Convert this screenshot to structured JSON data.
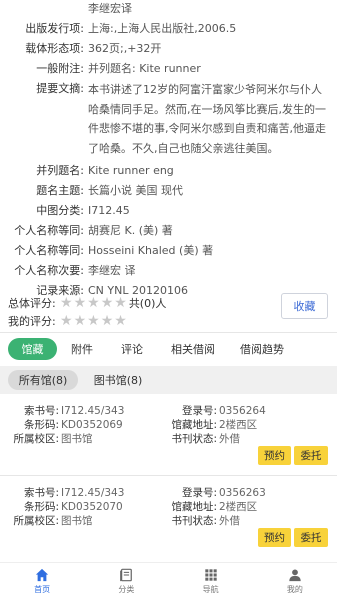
{
  "meta": [
    {
      "label": "",
      "value": "李继宏译"
    },
    {
      "label": "出版发行项:",
      "value": "上海:,上海人民出版社,2006.5"
    },
    {
      "label": "载体形态项:",
      "value": "362页;,+32开"
    },
    {
      "label": "一般附注:",
      "value": "并列题名: Kite runner"
    },
    {
      "label": "提要文摘:",
      "value": "本书讲述了12岁的阿富汗富家少爷阿米尔与仆人哈桑情同手足。然而,在一场风筝比赛后,发生的一件悲惨不堪的事,令阿米尔感到自责和痛苦,他逼走了哈桑。不久,自己也随父亲逃往美国。"
    },
    {
      "label": "并列题名:",
      "value": "Kite runner eng"
    },
    {
      "label": "题名主题:",
      "value": "长篇小说 美国 现代"
    },
    {
      "label": "中图分类:",
      "value": "I712.45"
    },
    {
      "label": "个人名称等同:",
      "value": "胡赛尼 K. (美) 著"
    },
    {
      "label": "个人名称等同:",
      "value": "Hosseini Khaled (美) 著"
    },
    {
      "label": "个人名称次要:",
      "value": "李继宏 译"
    },
    {
      "label": "记录来源:",
      "value": "CN YNL 20120106"
    }
  ],
  "rating": {
    "total_label": "总体评分:",
    "count_text": "共(0)人",
    "mine_label": "我的评分:",
    "stars": 5,
    "collect_label": "收藏"
  },
  "tabs": [
    "馆藏",
    "附件",
    "评论",
    "相关借阅",
    "借阅趋势"
  ],
  "subtabs": [
    "所有馆(8)",
    "图书馆(8)"
  ],
  "holdings": [
    {
      "call_no_label": "索书号:",
      "call_no": "I712.45/343",
      "barcode_label": "条形码:",
      "barcode": "KD0352069",
      "campus_label": "所属校区:",
      "campus": "图书馆",
      "reg_label": "登录号:",
      "reg": "0356264",
      "loc_label": "馆藏地址:",
      "loc": "2楼西区",
      "status_label": "书刊状态:",
      "status": "外借",
      "reserve_label": "预约",
      "delegate_label": "委托"
    },
    {
      "call_no_label": "索书号:",
      "call_no": "I712.45/343",
      "barcode_label": "条形码:",
      "barcode": "KD0352070",
      "campus_label": "所属校区:",
      "campus": "图书馆",
      "reg_label": "登录号:",
      "reg": "0356263",
      "loc_label": "馆藏地址:",
      "loc": "2楼西区",
      "status_label": "书刊状态:",
      "status": "外借",
      "reserve_label": "预约",
      "delegate_label": "委托"
    }
  ],
  "nav": [
    {
      "label": "首页",
      "icon": "home-icon",
      "active": true
    },
    {
      "label": "分类",
      "icon": "book-icon",
      "active": false
    },
    {
      "label": "导航",
      "icon": "grid-icon",
      "active": false
    },
    {
      "label": "我的",
      "icon": "user-icon",
      "active": false
    }
  ],
  "colors": {
    "accent_green": "#3bb273",
    "nav_active": "#2f6ee0",
    "button_yellow": "#f8d23a",
    "collect_text": "#3d6bd6"
  }
}
